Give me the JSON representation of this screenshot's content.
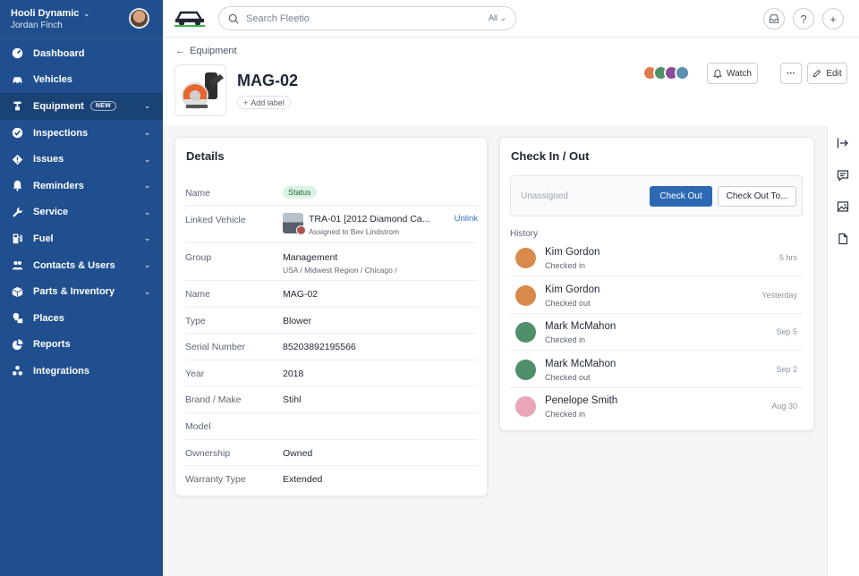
{
  "org": {
    "name": "Hooli Dynamic",
    "user": "Jordan Finch"
  },
  "nav": [
    {
      "label": "Dashboard",
      "icon": "dashboard-icon",
      "caret": false
    },
    {
      "label": "Vehicles",
      "icon": "car-icon",
      "caret": false
    },
    {
      "label": "Equipment",
      "icon": "equipment-icon",
      "caret": true,
      "badge": "NEW",
      "active": true
    },
    {
      "label": "Inspections",
      "icon": "check-circle-icon",
      "caret": true
    },
    {
      "label": "Issues",
      "icon": "warning-icon",
      "caret": true
    },
    {
      "label": "Reminders",
      "icon": "bell-icon",
      "caret": true
    },
    {
      "label": "Service",
      "icon": "wrench-icon",
      "caret": true
    },
    {
      "label": "Fuel",
      "icon": "fuel-icon",
      "caret": true
    },
    {
      "label": "Contacts & Users",
      "icon": "people-icon",
      "caret": true
    },
    {
      "label": "Parts & Inventory",
      "icon": "box-icon",
      "caret": true
    },
    {
      "label": "Places",
      "icon": "places-icon",
      "caret": false
    },
    {
      "label": "Reports",
      "icon": "pie-chart-icon",
      "caret": false
    },
    {
      "label": "Integrations",
      "icon": "integrations-icon",
      "caret": false
    }
  ],
  "search": {
    "placeholder": "Search Fleetio",
    "scope": "All"
  },
  "breadcrumb": {
    "label": "Equipment"
  },
  "asset": {
    "title": "MAG-02",
    "add_label": "Add label"
  },
  "header_actions": {
    "watch": "Watch",
    "more": "···",
    "edit": "Edit"
  },
  "details": {
    "title": "Details",
    "status_label": "Name",
    "status_value": "Status",
    "linked_vehicle": {
      "label": "Linked Vehicle",
      "name": "TRA-01 [2012 Diamond Ca...",
      "assigned": "Assigned to Bev Lindstrom",
      "action": "Unlink"
    },
    "group": {
      "label": "Group",
      "value": "Management",
      "path": "USA / Midwest Region / Chicago /"
    },
    "rows": [
      {
        "label": "Name",
        "value": "MAG-02"
      },
      {
        "label": "Type",
        "value": "Blower"
      },
      {
        "label": "Serial Number",
        "value": "85203892195566"
      },
      {
        "label": "Year",
        "value": "2018"
      },
      {
        "label": "Brand / Make",
        "value": "Stihl"
      },
      {
        "label": "Model",
        "value": ""
      },
      {
        "label": "Ownership",
        "value": "Owned"
      },
      {
        "label": "Warranty Type",
        "value": "Extended"
      }
    ]
  },
  "checkin": {
    "title": "Check In / Out",
    "unassigned": "Unassigned",
    "check_out": "Check Out",
    "check_out_to": "Check Out To...",
    "history_label": "History",
    "history": [
      {
        "name": "Kim Gordon",
        "status": "Checked in",
        "time": "5 hrs",
        "color": "#d98a4a"
      },
      {
        "name": "Kim Gordon",
        "status": "Checked out",
        "time": "Yesterday",
        "color": "#d98a4a"
      },
      {
        "name": "Mark McMahon",
        "status": "Checked in",
        "time": "Sep 5",
        "color": "#4f8f6a"
      },
      {
        "name": "Mark McMahon",
        "status": "Checked out",
        "time": "Sep 2",
        "color": "#4f8f6a"
      },
      {
        "name": "Penelope Smith",
        "status": "Checked in",
        "time": "Aug 30",
        "color": "#e8a6b8"
      }
    ]
  },
  "colors": {
    "sidebar": "#1f4f8f",
    "primary": "#2d6ab3",
    "status_bg": "#dcf3e3"
  }
}
